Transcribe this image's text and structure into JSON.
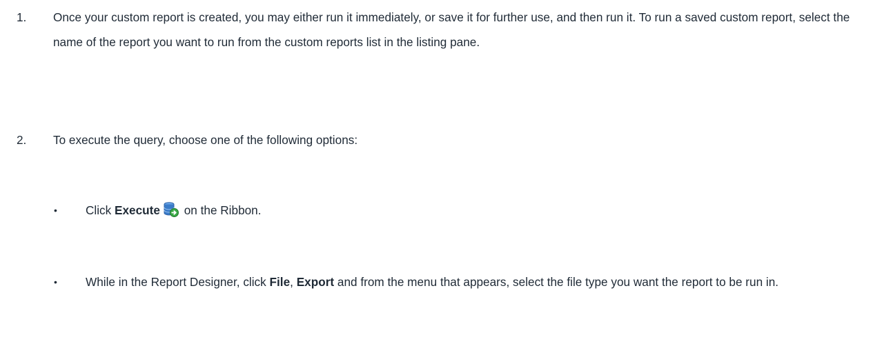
{
  "steps": [
    {
      "number": "1.",
      "text": "Once your custom report is created, you may either run it immediately, or save it for further use, and then run it. To run a saved custom report, select the name of the report you want to run from the custom reports list in the listing pane."
    },
    {
      "number": "2.",
      "text": "To execute the query, choose one of the following options:"
    }
  ],
  "bullets": [
    {
      "marker": "•",
      "prefix": "Click ",
      "bold": "Execute",
      "icon": "execute-database-icon",
      "suffix": " on the Ribbon."
    },
    {
      "marker": "•",
      "prefix": "While in the Report Designer, click ",
      "bold1": "File",
      "sep": ", ",
      "bold2": "Export",
      "suffix": " and from the menu that appears, select the file type you want the report to be run in."
    }
  ],
  "colors": {
    "text": "#1f2a36",
    "icon_blue": "#3a7bc8",
    "icon_green": "#3aa845"
  }
}
